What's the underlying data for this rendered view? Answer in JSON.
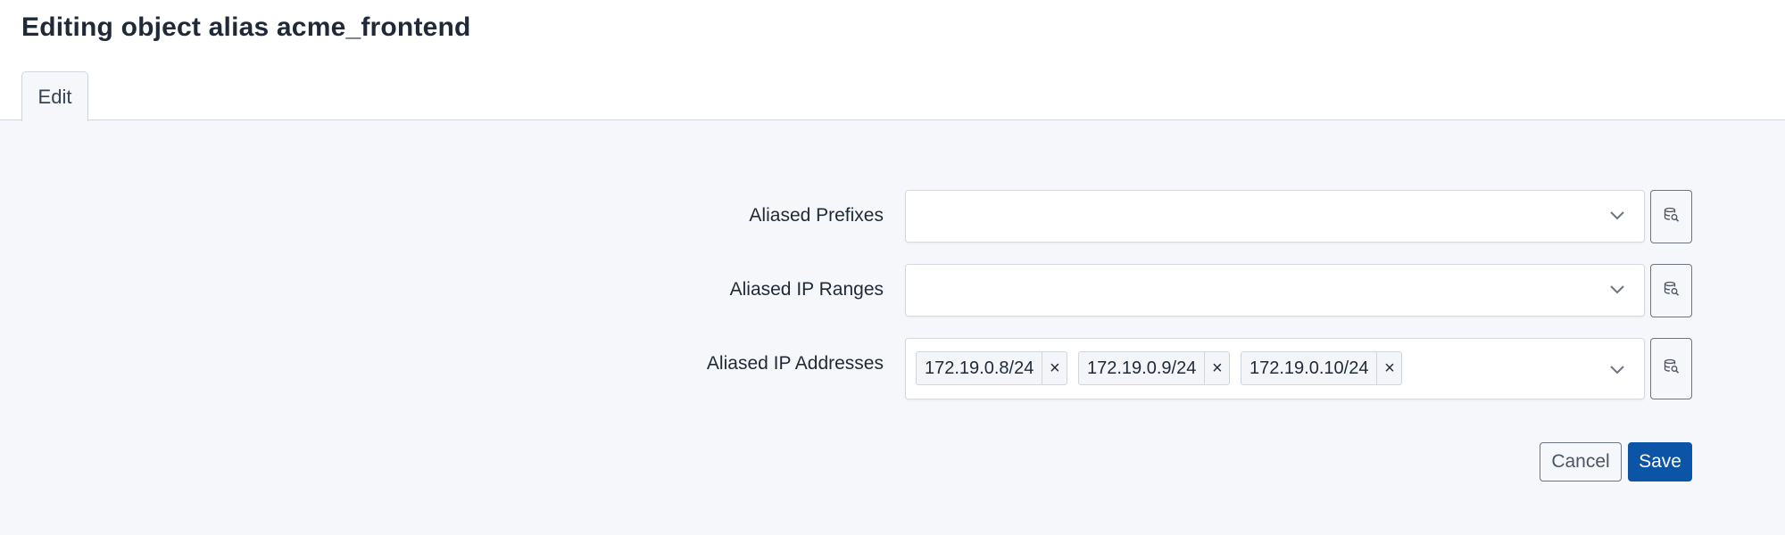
{
  "page": {
    "title": "Editing object alias acme_frontend"
  },
  "tabs": [
    {
      "label": "Edit",
      "active": true
    }
  ],
  "form": {
    "fields": [
      {
        "label": "Aliased Prefixes",
        "selected": []
      },
      {
        "label": "Aliased IP Ranges",
        "selected": []
      },
      {
        "label": "Aliased IP Addresses",
        "selected": [
          "172.19.0.8/24",
          "172.19.0.9/24",
          "172.19.0.10/24"
        ]
      }
    ],
    "chip_remove_symbol": "×",
    "icons": {
      "dropdown": "chevron-down-icon",
      "lookup": "object-selector-icon"
    }
  },
  "actions": {
    "cancel_label": "Cancel",
    "save_label": "Save"
  },
  "colors": {
    "primary": "#0b54a6",
    "background": "#f6f7fa",
    "border": "#d3d9e1"
  }
}
